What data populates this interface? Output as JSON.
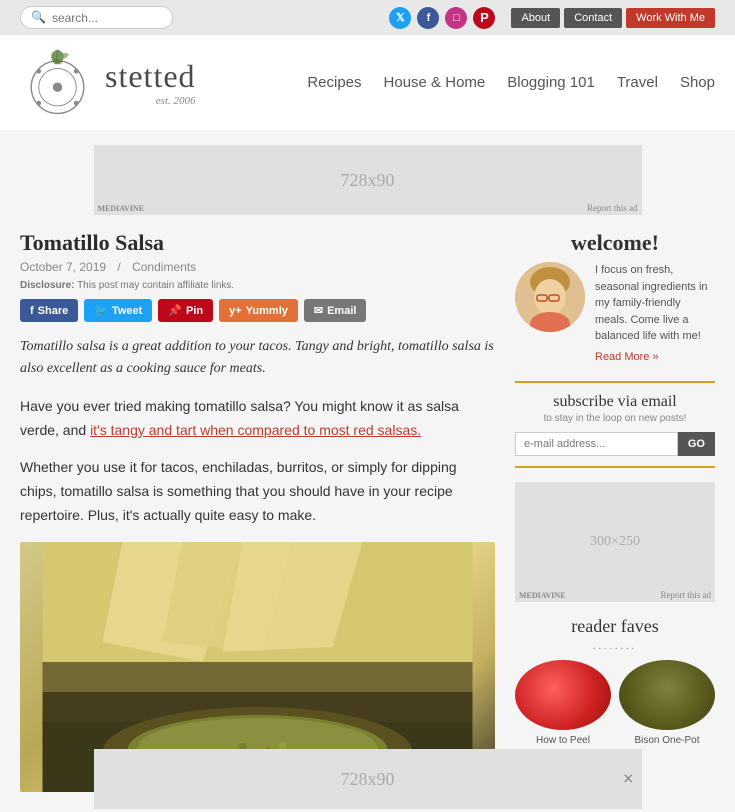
{
  "topbar": {
    "search_placeholder": "search...",
    "social": [
      {
        "name": "twitter",
        "label": "T",
        "class": "twitter"
      },
      {
        "name": "facebook",
        "label": "f",
        "class": "facebook"
      },
      {
        "name": "instagram",
        "label": "i",
        "class": "instagram"
      },
      {
        "name": "pinterest",
        "label": "p",
        "class": "pinterest"
      }
    ],
    "buttons": [
      {
        "label": "About",
        "class": "btn-about"
      },
      {
        "label": "Contact",
        "class": "btn-contact"
      },
      {
        "label": "Work With Me",
        "class": "btn-work"
      }
    ]
  },
  "header": {
    "logo_name": "stetted",
    "logo_est": "est. 2006",
    "nav": [
      "Recipes",
      "House & Home",
      "Blogging 101",
      "Travel",
      "Shop"
    ]
  },
  "ad_top": {
    "size": "728x90",
    "mediavine": "MEDIAVINE",
    "report": "Report this ad"
  },
  "article": {
    "title": "Tomatillo Salsa",
    "date": "October 7, 2019",
    "category": "Condiments",
    "disclosure": "Disclosure:",
    "disclosure_text": "This post may contain affiliate links.",
    "share_buttons": [
      {
        "label": "Share",
        "class": "share-fb"
      },
      {
        "label": "Tweet",
        "class": "share-tw"
      },
      {
        "label": "Pin",
        "class": "share-pin"
      },
      {
        "label": "Yummly",
        "class": "share-yum"
      },
      {
        "label": "Email",
        "class": "share-email"
      }
    ],
    "intro": "Tomatillo salsa is a great addition to your tacos. Tangy and bright, tomatillo salsa is also excellent as a cooking sauce for meats.",
    "body_p1": "Have you ever tried making tomatillo salsa? You might know it as salsa verde, and it's tangy and tart when compared to most red salsas.",
    "body_p1_link": "it's tangy and tart when compared to most red salsas",
    "body_p2": "Whether you use it for tacos, enchiladas, burritos, or simply for dipping chips, tomatillo salsa is something that you should have in your recipe repertoire. Plus, it's actually quite easy to make."
  },
  "sidebar": {
    "welcome_title": "welcome!",
    "welcome_tagline": "",
    "welcome_text": "I focus on fresh, seasonal ingredients in my family-friendly meals. Come live a balanced life with me!",
    "welcome_readmore": "Read More »",
    "subscribe_title": "subscribe via email",
    "subscribe_sub": "to stay in the loop on new posts!",
    "subscribe_placeholder": "e-mail address...",
    "subscribe_btn": "GO",
    "ad_size": "300×250",
    "ad_mediavine": "MEDIAVINE",
    "ad_report": "Report this ad",
    "reader_faves_title": "reader faves",
    "faves_dots": "........",
    "faves": [
      {
        "label": "How to Peel"
      },
      {
        "label": "Bison One-Pot"
      }
    ]
  },
  "bottom_ad": {
    "size": "728x90",
    "close_label": "×"
  }
}
